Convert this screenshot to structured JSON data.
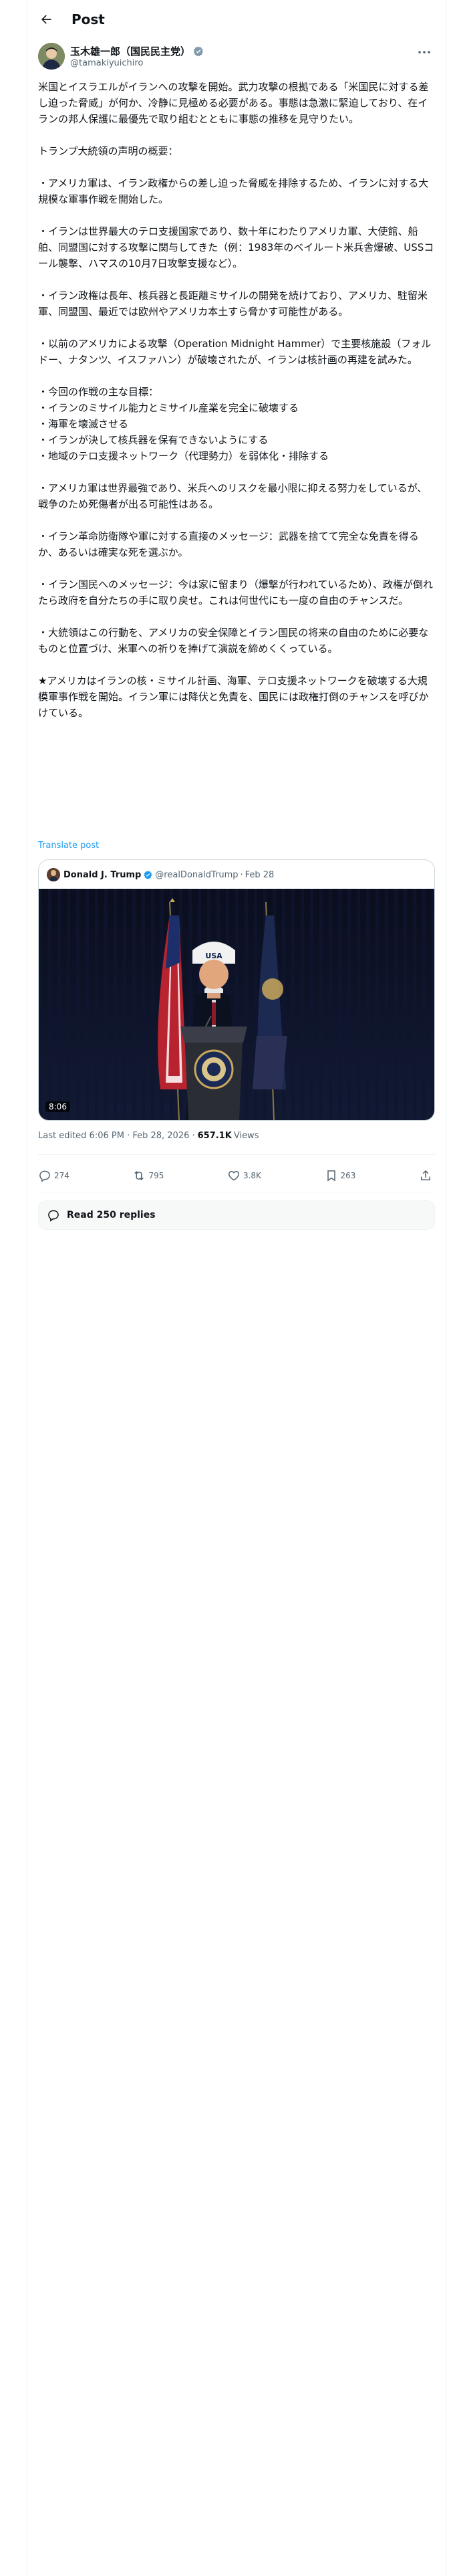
{
  "header": {
    "title": "Post"
  },
  "author": {
    "display_name": "玉木雄一郎（国民民主党）",
    "handle": "@tamakiyuichiro"
  },
  "post": {
    "paragraphs": [
      "米国とイスラエルがイランへの攻撃を開始。武力攻撃の根拠である「米国民に対する差し迫った脅威」が何か、冷静に見極める必要がある。事態は急激に緊迫しており、在イランの邦人保護に最優先で取り組むとともに事態の推移を見守りたい。",
      "",
      "トランプ大統領の声明の概要：",
      "",
      "・アメリカ軍は、イラン政権からの差し迫った脅威を排除するため、イランに対する大規模な軍事作戦を開始した。",
      "",
      "・イランは世界最大のテロ支援国家であり、数十年にわたりアメリカ軍、大使館、船舶、同盟国に対する攻撃に関与してきた（例：1983年のベイルート米兵舎爆破、USSコール襲撃、ハマスの10月7日攻撃支援など）。",
      "",
      "・イラン政権は長年、核兵器と長距離ミサイルの開発を続けており、アメリカ、駐留米軍、同盟国、最近では欧州やアメリカ本土すら脅かす可能性がある。",
      "",
      "・以前のアメリカによる攻撃（Operation Midnight Hammer）で主要核施設（フォルドー、ナタンツ、イスファハン）が破壊されたが、イランは核計画の再建を試みた。",
      "",
      "・今回の作戦の主な目標：",
      "・イランのミサイル能力とミサイル産業を完全に破壊する",
      "・海軍を壊滅させる",
      "・イランが決して核兵器を保有できないようにする",
      "・地域のテロ支援ネットワーク（代理勢力）を弱体化・排除する",
      "",
      "・アメリカ軍は世界最強であり、米兵へのリスクを最小限に抑える努力をしているが、戦争のため死傷者が出る可能性はある。",
      "",
      "・イラン革命防衛隊や軍に対する直接のメッセージ：武器を捨てて完全な免責を得るか、あるいは確実な死を選ぶか。",
      "",
      "・イラン国民へのメッセージ：今は家に留まり（爆撃が行われているため）、政権が倒れたら政府を自分たちの手に取り戻せ。これは何世代にも一度の自由のチャンスだ。",
      "",
      "・大統領はこの行動を、アメリカの安全保障とイラン国民の将来の自由のために必要なものと位置づけ、米軍への祈りを捧げて演説を締めくくっている。",
      "",
      "★アメリカはイランの核・ミサイル計画、海軍、テロ支援ネットワークを破壊する大規模軍事作戦を開始。イラン軍には降伏と免責を、国民には政権打倒のチャンスを呼びかけている。"
    ],
    "translate_label": "Translate post"
  },
  "quote": {
    "name": "Donald J. Trump",
    "handle": "@realDonaldTrump",
    "separator": "·",
    "date": "Feb 28",
    "duration": "8:06",
    "cap_text": "USA"
  },
  "meta": {
    "edited": "Last edited 6:06 PM · Feb 28, 2026 ·",
    "views_count": "657.1K",
    "views_label": "Views"
  },
  "actions": {
    "replies": "274",
    "reposts": "795",
    "likes": "3.8K",
    "bookmarks": "263"
  },
  "read_replies": {
    "label": "Read 250 replies"
  },
  "colors": {
    "accent": "#1d9bf0",
    "text": "#0f1419",
    "muted": "#536471",
    "border": "#cfd9de"
  }
}
